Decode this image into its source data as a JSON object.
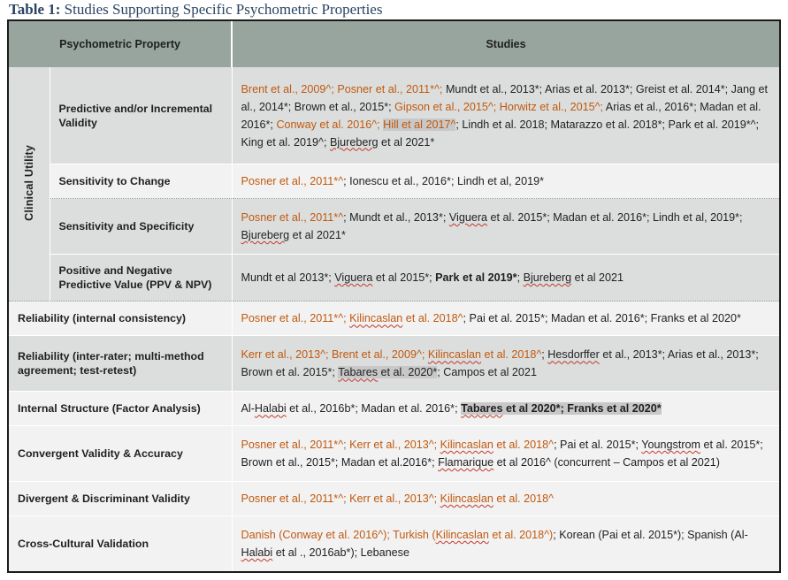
{
  "caption": {
    "number": "Table 1:",
    "text": " Studies Supporting Specific Psychometric Properties"
  },
  "header": {
    "property": "Psychometric Property",
    "studies": "Studies"
  },
  "group_label": "Clinical Utility",
  "colors": {
    "header_bg": "#97a59e",
    "band_light": "#f2f2f2",
    "band_dark": "#dcdedd",
    "citation_orange": "#c0590f",
    "highlight_gray": "#c8c8c8",
    "caption_navy": "#2a4463",
    "spellcheck_red": "#c0392b"
  },
  "rows": [
    {
      "property": "Predictive and/or Incremental Validity",
      "studies_plain": "Brent et al., 2009^; Posner et al., 2011*^;  Mundt et al., 2013*; Arias et al. 2013*; Greist et al. 2014*;  Jang et al., 2014*; Brown et al., 2015*; Gipson et al., 2015^; Horwitz et al., 2015^; Arias et al., 2016*; Madan et al. 2016*; Conway et al. 2016^; Hill et al 2017^; Lindh et al. 2018; Matarazzo et al. 2018*; Park et al. 2019*^; King et al. 2019^; Bjureberg et al 2021*"
    },
    {
      "property": "Sensitivity to Change",
      "studies_plain": "Posner et al., 2011*^; Ionescu et al., 2016*; Lindh et al, 2019*"
    },
    {
      "property": "Sensitivity and Specificity",
      "studies_plain": "Posner et al., 2011*^;  Mundt et al., 2013*; Viguera et al. 2015*; Madan et al. 2016*; Lindh et al, 2019*; Bjureberg et al 2021*"
    },
    {
      "property": "Positive and Negative Predictive Value (PPV & NPV)",
      "studies_plain": "Mundt et al 2013*; Viguera et al 2015*; Park et al 2019*; Bjureberg et al 2021"
    },
    {
      "property": "Reliability (internal consistency)",
      "studies_plain": "Posner et al., 2011*^; Kilincaslan et al. 2018^; Pai et al. 2015*; Madan et al. 2016*; Franks et al 2020*"
    },
    {
      "property": "Reliability (inter-rater; multi-method agreement; test-retest)",
      "studies_plain": "Kerr et al., 2013^; Brent et al., 2009^; Kilincaslan et al. 2018^; Hesdorffer et al., 2013*; Arias et al., 2013*; Brown et al. 2015*; Tabares et al. 2020*; Campos et al 2021"
    },
    {
      "property": "Internal Structure (Factor Analysis)",
      "studies_plain": "Al-Halabi et al., 2016b*; Madan et al. 2016*; Tabares et al 2020*; Franks et al 2020*"
    },
    {
      "property": "Convergent Validity & Accuracy",
      "studies_plain": "Posner et al., 2011*^; Kerr et al., 2013^; Kilincaslan et al. 2018^; Pai et al. 2015*; Youngstrom et al. 2015*; Brown et al., 2015*; Madan et al.2016*; Flamarique et al 2016^     (concurrent – Campos et al 2021)"
    },
    {
      "property": "Divergent & Discriminant Validity",
      "studies_plain": "Posner et al., 2011*^; Kerr et al., 2013^; Kilincaslan et al. 2018^"
    },
    {
      "property": "Cross-Cultural Validation",
      "studies_plain": "Danish (Conway et al. 2016^); Turkish (Kilincaslan et al. 2018^); Korean (Pai et al. 2015*); Spanish (Al-Halabi et al ., 2016ab*); Lebanese"
    }
  ],
  "studies_runs": {
    "r0": [
      {
        "t": "Brent et al., 2009^; Posner et al., 2011*^;  ",
        "c": "orange"
      },
      {
        "t": "Mundt et al., 2013*; Arias et al. 2013*; Greist et al. 2014*;  Jang et al., 2014*; Brown et al., 2015*; ",
        "c": "plain"
      },
      {
        "t": "Gipson et al., 2015^; Horwitz et al., 2015^; ",
        "c": "orange"
      },
      {
        "t": "Arias et al., 2016*; Madan et al. 2016*; ",
        "c": "plain"
      },
      {
        "t": "Conway et al. 2016^; ",
        "c": "orange"
      },
      {
        "t": "Hill et al 2017^",
        "c": "orange-hl"
      },
      {
        "t": "; Lindh et al. 2018; Matarazzo et al. 2018*; Park et al. 2019*^; King et al. 2019^; ",
        "c": "plain"
      },
      {
        "t": "Bjureberg",
        "c": "plain-sq"
      },
      {
        "t": " et al 2021*",
        "c": "plain"
      }
    ],
    "r1": [
      {
        "t": "Posner et al., 2011*^",
        "c": "orange"
      },
      {
        "t": "; Ionescu et al., 2016*; Lindh et al, 2019*",
        "c": "plain"
      }
    ],
    "r2": [
      {
        "t": "Posner et al., 2011*^",
        "c": "orange"
      },
      {
        "t": ";  Mundt et al., 2013*; ",
        "c": "plain"
      },
      {
        "t": "Viguera",
        "c": "plain-sq"
      },
      {
        "t": " et al. 2015*; Madan et al. 2016*; Lindh et al, 2019*; ",
        "c": "plain"
      },
      {
        "t": "Bjureberg",
        "c": "plain-sq"
      },
      {
        "t": " et al 2021*",
        "c": "plain"
      }
    ],
    "r3": [
      {
        "t": "Mundt et al 2013*; ",
        "c": "plain"
      },
      {
        "t": "Viguera",
        "c": "plain-sq"
      },
      {
        "t": " et al 2015*; ",
        "c": "plain"
      },
      {
        "t": "Park et al 2019*",
        "c": "bold"
      },
      {
        "t": "; ",
        "c": "plain"
      },
      {
        "t": "Bjureberg",
        "c": "plain-sq"
      },
      {
        "t": " et al 2021",
        "c": "plain"
      }
    ],
    "r4": [
      {
        "t": "Posner et al., 2011*^; ",
        "c": "orange"
      },
      {
        "t": "Kilincaslan",
        "c": "orange-sq"
      },
      {
        "t": " et al. 2018^",
        "c": "orange"
      },
      {
        "t": "; Pai et al. 2015*; Madan et al. 2016*; Franks et al 2020*",
        "c": "plain"
      }
    ],
    "r5": [
      {
        "t": "Kerr et al., 2013^; Brent et al., 2009^; ",
        "c": "orange"
      },
      {
        "t": "Kilincaslan",
        "c": "orange-sq"
      },
      {
        "t": " et al. 2018^",
        "c": "orange"
      },
      {
        "t": "; ",
        "c": "plain"
      },
      {
        "t": "Hesdorffer",
        "c": "plain-sq"
      },
      {
        "t": " et al., 2013*; Arias et al., 2013*; Brown et al. 2015*; ",
        "c": "plain"
      },
      {
        "t": "Tabares",
        "c": "plain-sq-hl"
      },
      {
        "t": " et al. 2020*",
        "c": "plain-hl"
      },
      {
        "t": "; Campos et al 2021",
        "c": "plain"
      }
    ],
    "r6": [
      {
        "t": "Al-",
        "c": "plain"
      },
      {
        "t": "Halabi",
        "c": "plain-sq"
      },
      {
        "t": " et al., 2016b*; Madan et al. 2016*; ",
        "c": "plain"
      },
      {
        "t": "Tabares",
        "c": "bold-sq-hl"
      },
      {
        "t": " et al 2020*; Franks et al 2020*",
        "c": "bold-hl"
      }
    ],
    "r7": [
      {
        "t": "Posner et al., 2011*^; Kerr et al., 2013^; ",
        "c": "orange"
      },
      {
        "t": "Kilincaslan",
        "c": "orange-sq"
      },
      {
        "t": " et al. 2018^",
        "c": "orange"
      },
      {
        "t": "; Pai et al. 2015*; ",
        "c": "plain"
      },
      {
        "t": "Youngstrom",
        "c": "plain-sq"
      },
      {
        "t": " et al. 2015*; Brown et al., 2015*; Madan et al.2016*; ",
        "c": "plain"
      },
      {
        "t": "Flamarique",
        "c": "plain-sq"
      },
      {
        "t": " et al 2016^     (concurrent – Campos et al 2021)",
        "c": "plain"
      }
    ],
    "r8": [
      {
        "t": "Posner et al., 2011*^; Kerr et al., 2013^; ",
        "c": "orange"
      },
      {
        "t": "Kilincaslan",
        "c": "orange-sq"
      },
      {
        "t": " et al. 2018^",
        "c": "orange"
      }
    ],
    "r9": [
      {
        "t": "Danish (Conway et al. 2016^); Turkish (",
        "c": "orange"
      },
      {
        "t": "Kilincaslan",
        "c": "orange-sq"
      },
      {
        "t": " et al. 2018^)",
        "c": "orange"
      },
      {
        "t": "; Korean (Pai et al. 2015*); Spanish (Al-",
        "c": "plain"
      },
      {
        "t": "Halabi",
        "c": "plain-sq"
      },
      {
        "t": " et al ., 2016ab*); Lebanese",
        "c": "plain"
      }
    ]
  }
}
